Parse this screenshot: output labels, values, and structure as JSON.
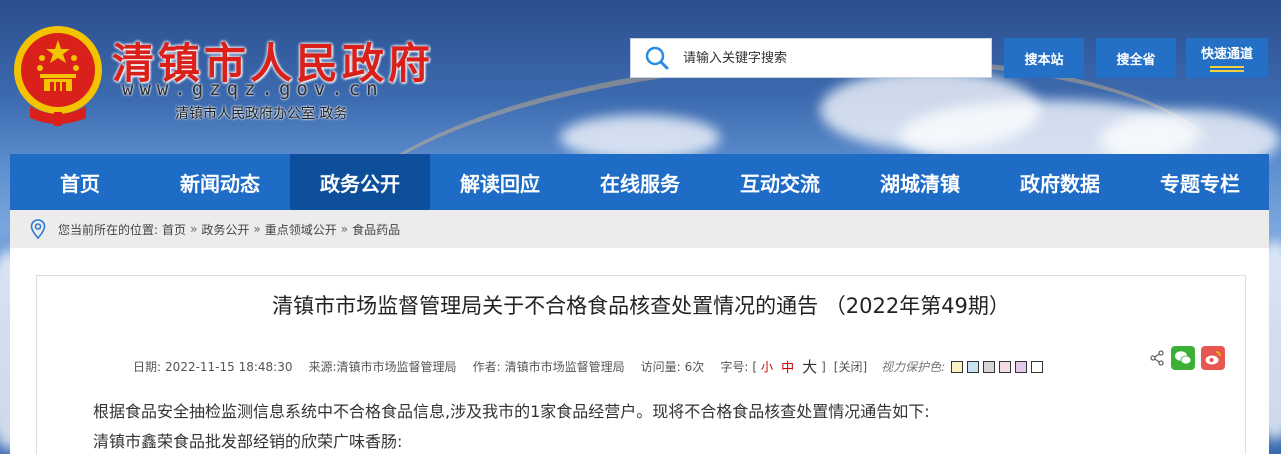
{
  "header": {
    "site_title": "清镇市人民政府",
    "site_url": "www.gzqz.gov.cn",
    "site_subtitle": "清镇市人民政府办公室.政务",
    "search_placeholder": "请输入关键字搜索",
    "search_site_label": "搜本站",
    "search_province_label": "搜全省",
    "fast_channel_label": "快速通道"
  },
  "nav": {
    "items": [
      "首页",
      "新闻动态",
      "政务公开",
      "解读回应",
      "在线服务",
      "互动交流",
      "湖城清镇",
      "政府数据",
      "专题专栏"
    ],
    "active": "政务公开"
  },
  "breadcrumb": {
    "prefix": "您当前所在的位置:",
    "items": [
      "首页",
      "政务公开",
      "重点领域公开",
      "食品药品"
    ],
    "separator": "»"
  },
  "article": {
    "title": "清镇市市场监督管理局关于不合格食品核查处置情况的通告 （2022年第49期）",
    "date_label": "日期:",
    "date": "2022-11-15 18:48:30",
    "source_label": "来源:",
    "source": "清镇市市场监督管理局",
    "author_label": "作者:",
    "author": "清镇市市场监督管理局",
    "views_label": "访问量:",
    "views": "6次",
    "font_label": "字号:",
    "font_open": "[",
    "font_small": "小",
    "font_medium": "中",
    "font_large": "大",
    "font_close": "]",
    "close_label": "[关闭]",
    "protect_label": "视力保护色:",
    "protect_colors": [
      "#fbf3c3",
      "#c6e4f1",
      "#d5d5d5",
      "#f6dde4",
      "#e3c8ec",
      "#ffffff"
    ],
    "paragraphs": [
      "根据食品安全抽检监测信息系统中不合格食品信息,涉及我市的1家食品经营户。现将不合格食品核查处置情况通告如下:",
      "清镇市鑫荣食品批发部经销的欣荣广味香肠:"
    ]
  },
  "colors": {
    "brand_red": "#d9201a",
    "nav_blue": "#1f6cc7",
    "nav_active": "#0e4f9b",
    "button_blue": "#2470c6"
  }
}
